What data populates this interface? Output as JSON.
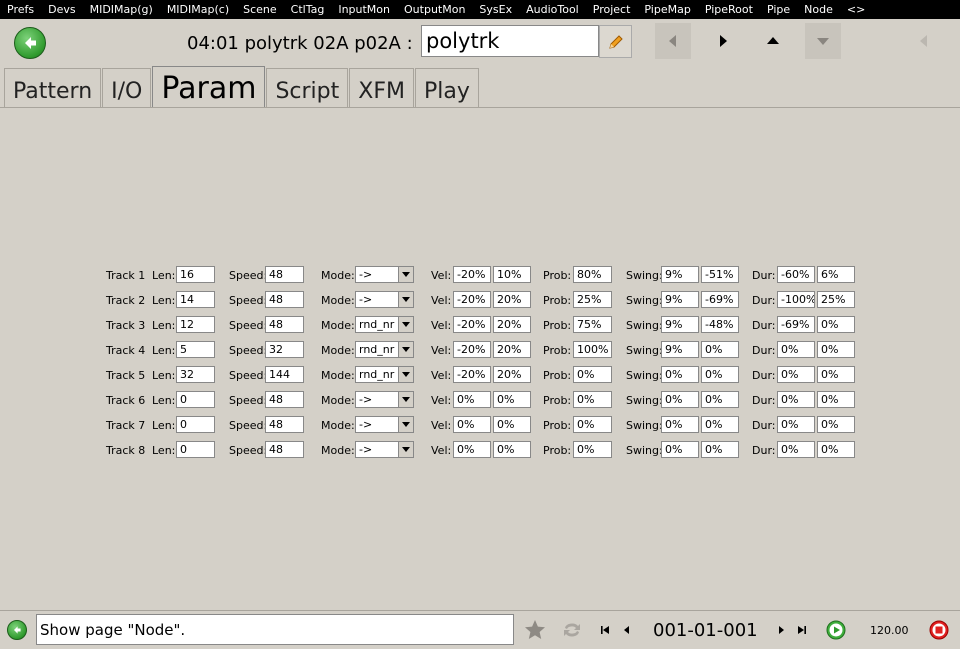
{
  "menu": [
    "Prefs",
    "Devs",
    "MIDIMap(g)",
    "MIDIMap(c)",
    "Scene",
    "CtlTag",
    "InputMon",
    "OutputMon",
    "SysEx",
    "AudioTool",
    "Project",
    "PipeMap",
    "PipeRoot",
    "Pipe",
    "Node",
    "<>"
  ],
  "header": {
    "title": "04:01 polytrk  02A  p02A :",
    "name_value": "polytrk"
  },
  "tabs": [
    {
      "label": "Pattern",
      "active": false
    },
    {
      "label": "I/O",
      "active": false
    },
    {
      "label": "Param",
      "active": true
    },
    {
      "label": "Script",
      "active": false
    },
    {
      "label": "XFM",
      "active": false
    },
    {
      "label": "Play",
      "active": false
    }
  ],
  "labels": {
    "len": "Len:",
    "speed": "Speed:",
    "mode": "Mode:",
    "vel": "Vel:",
    "prob": "Prob:",
    "swing": "Swing:",
    "dur": "Dur:"
  },
  "tracks": [
    {
      "name": "Track 1",
      "len": "16",
      "speed": "48",
      "mode": "->",
      "vel1": "-20%",
      "vel2": "10%",
      "prob": "80%",
      "swing1": "9%",
      "swing2": "-51%",
      "dur1": "-60%",
      "dur2": "6%"
    },
    {
      "name": "Track 2",
      "len": "14",
      "speed": "48",
      "mode": "->",
      "vel1": "-20%",
      "vel2": "20%",
      "prob": "25%",
      "swing1": "9%",
      "swing2": "-69%",
      "dur1": "-100%",
      "dur2": "25%"
    },
    {
      "name": "Track 3",
      "len": "12",
      "speed": "48",
      "mode": "rnd_nr",
      "vel1": "-20%",
      "vel2": "20%",
      "prob": "75%",
      "swing1": "9%",
      "swing2": "-48%",
      "dur1": "-69%",
      "dur2": "0%"
    },
    {
      "name": "Track 4",
      "len": "5",
      "speed": "32",
      "mode": "rnd_nr",
      "vel1": "-20%",
      "vel2": "20%",
      "prob": "100%",
      "swing1": "9%",
      "swing2": "0%",
      "dur1": "0%",
      "dur2": "0%"
    },
    {
      "name": "Track 5",
      "len": "32",
      "speed": "144",
      "mode": "rnd_nr",
      "vel1": "-20%",
      "vel2": "20%",
      "prob": "0%",
      "swing1": "0%",
      "swing2": "0%",
      "dur1": "0%",
      "dur2": "0%"
    },
    {
      "name": "Track 6",
      "len": "0",
      "speed": "48",
      "mode": "->",
      "vel1": "0%",
      "vel2": "0%",
      "prob": "0%",
      "swing1": "0%",
      "swing2": "0%",
      "dur1": "0%",
      "dur2": "0%"
    },
    {
      "name": "Track 7",
      "len": "0",
      "speed": "48",
      "mode": "->",
      "vel1": "0%",
      "vel2": "0%",
      "prob": "0%",
      "swing1": "0%",
      "swing2": "0%",
      "dur1": "0%",
      "dur2": "0%"
    },
    {
      "name": "Track 8",
      "len": "0",
      "speed": "48",
      "mode": "->",
      "vel1": "0%",
      "vel2": "0%",
      "prob": "0%",
      "swing1": "0%",
      "swing2": "0%",
      "dur1": "0%",
      "dur2": "0%"
    }
  ],
  "footer": {
    "status": "Show page \"Node\".",
    "time": "001-01-001",
    "bpm": "120.00"
  },
  "colors": {
    "menu_bg": "#000000",
    "back_green": "#2f9a2d",
    "stop_red": "#e02020",
    "panel": "#d4d0c8"
  }
}
